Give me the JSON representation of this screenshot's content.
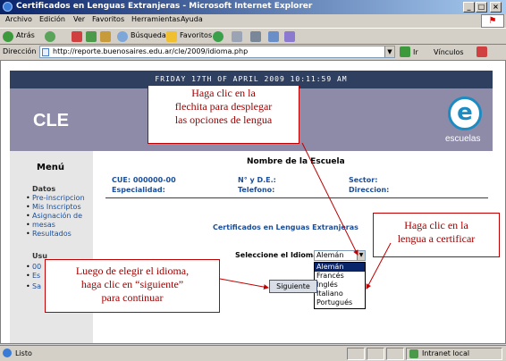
{
  "window": {
    "title": "Certificados en Lenguas Extranjeras - Microsoft Internet Explorer"
  },
  "menubar": {
    "items": [
      "Archivo",
      "Edición",
      "Ver",
      "Favoritos",
      "Herramientas",
      "Ayuda"
    ]
  },
  "toolbar": {
    "back_label": "Atrás",
    "search_label": "Búsqueda",
    "favorites_label": "Favoritos"
  },
  "address": {
    "label": "Dirección",
    "url": "http://reporte.buenosaires.edu.ar/cle/2009/idioma.php",
    "go_label": "Ir",
    "links_label": "Vínculos"
  },
  "page": {
    "date_bar": "FRIDAY 17TH OF APRIL 2009 10:11:59 AM",
    "brand": "CLE",
    "logo_text": "escuelas",
    "school_name": "Nombre de la Escuela",
    "info": {
      "cue": "CUE: 000000-00",
      "nde": "N° y D.E.:",
      "sector": "Sector:",
      "especialidad": "Especialidad:",
      "telefono": "Telefono:",
      "direccion": "Direccion:"
    },
    "cert_title": "Certificados en Lenguas Extranjeras",
    "select_label": "Seleccione el Idioma:",
    "select_value": "Alemán",
    "languages": [
      "Alemán",
      "Francés",
      "Inglés",
      "Italiano",
      "Portugués"
    ],
    "next_button": "Siguiente"
  },
  "sidebar": {
    "title": "Menú",
    "section1": "Datos",
    "links1": [
      "Pre-inscripcion",
      "Mis Inscriptos",
      "Asignación de",
      "mesas",
      "Resultados"
    ],
    "section2": "Usu",
    "links2": [
      "00",
      "Es",
      "Sa"
    ]
  },
  "callouts": {
    "top": [
      "Haga clic en la",
      "flechita para desplegar",
      "las opciones de lengua"
    ],
    "right": [
      "Haga clic en la",
      "lengua a certificar"
    ],
    "left": [
      "Luego de elegir el idioma,",
      "haga clic en “siguiente”",
      "para continuar"
    ]
  },
  "status": {
    "left": "Listo",
    "zone": "Intranet local"
  }
}
